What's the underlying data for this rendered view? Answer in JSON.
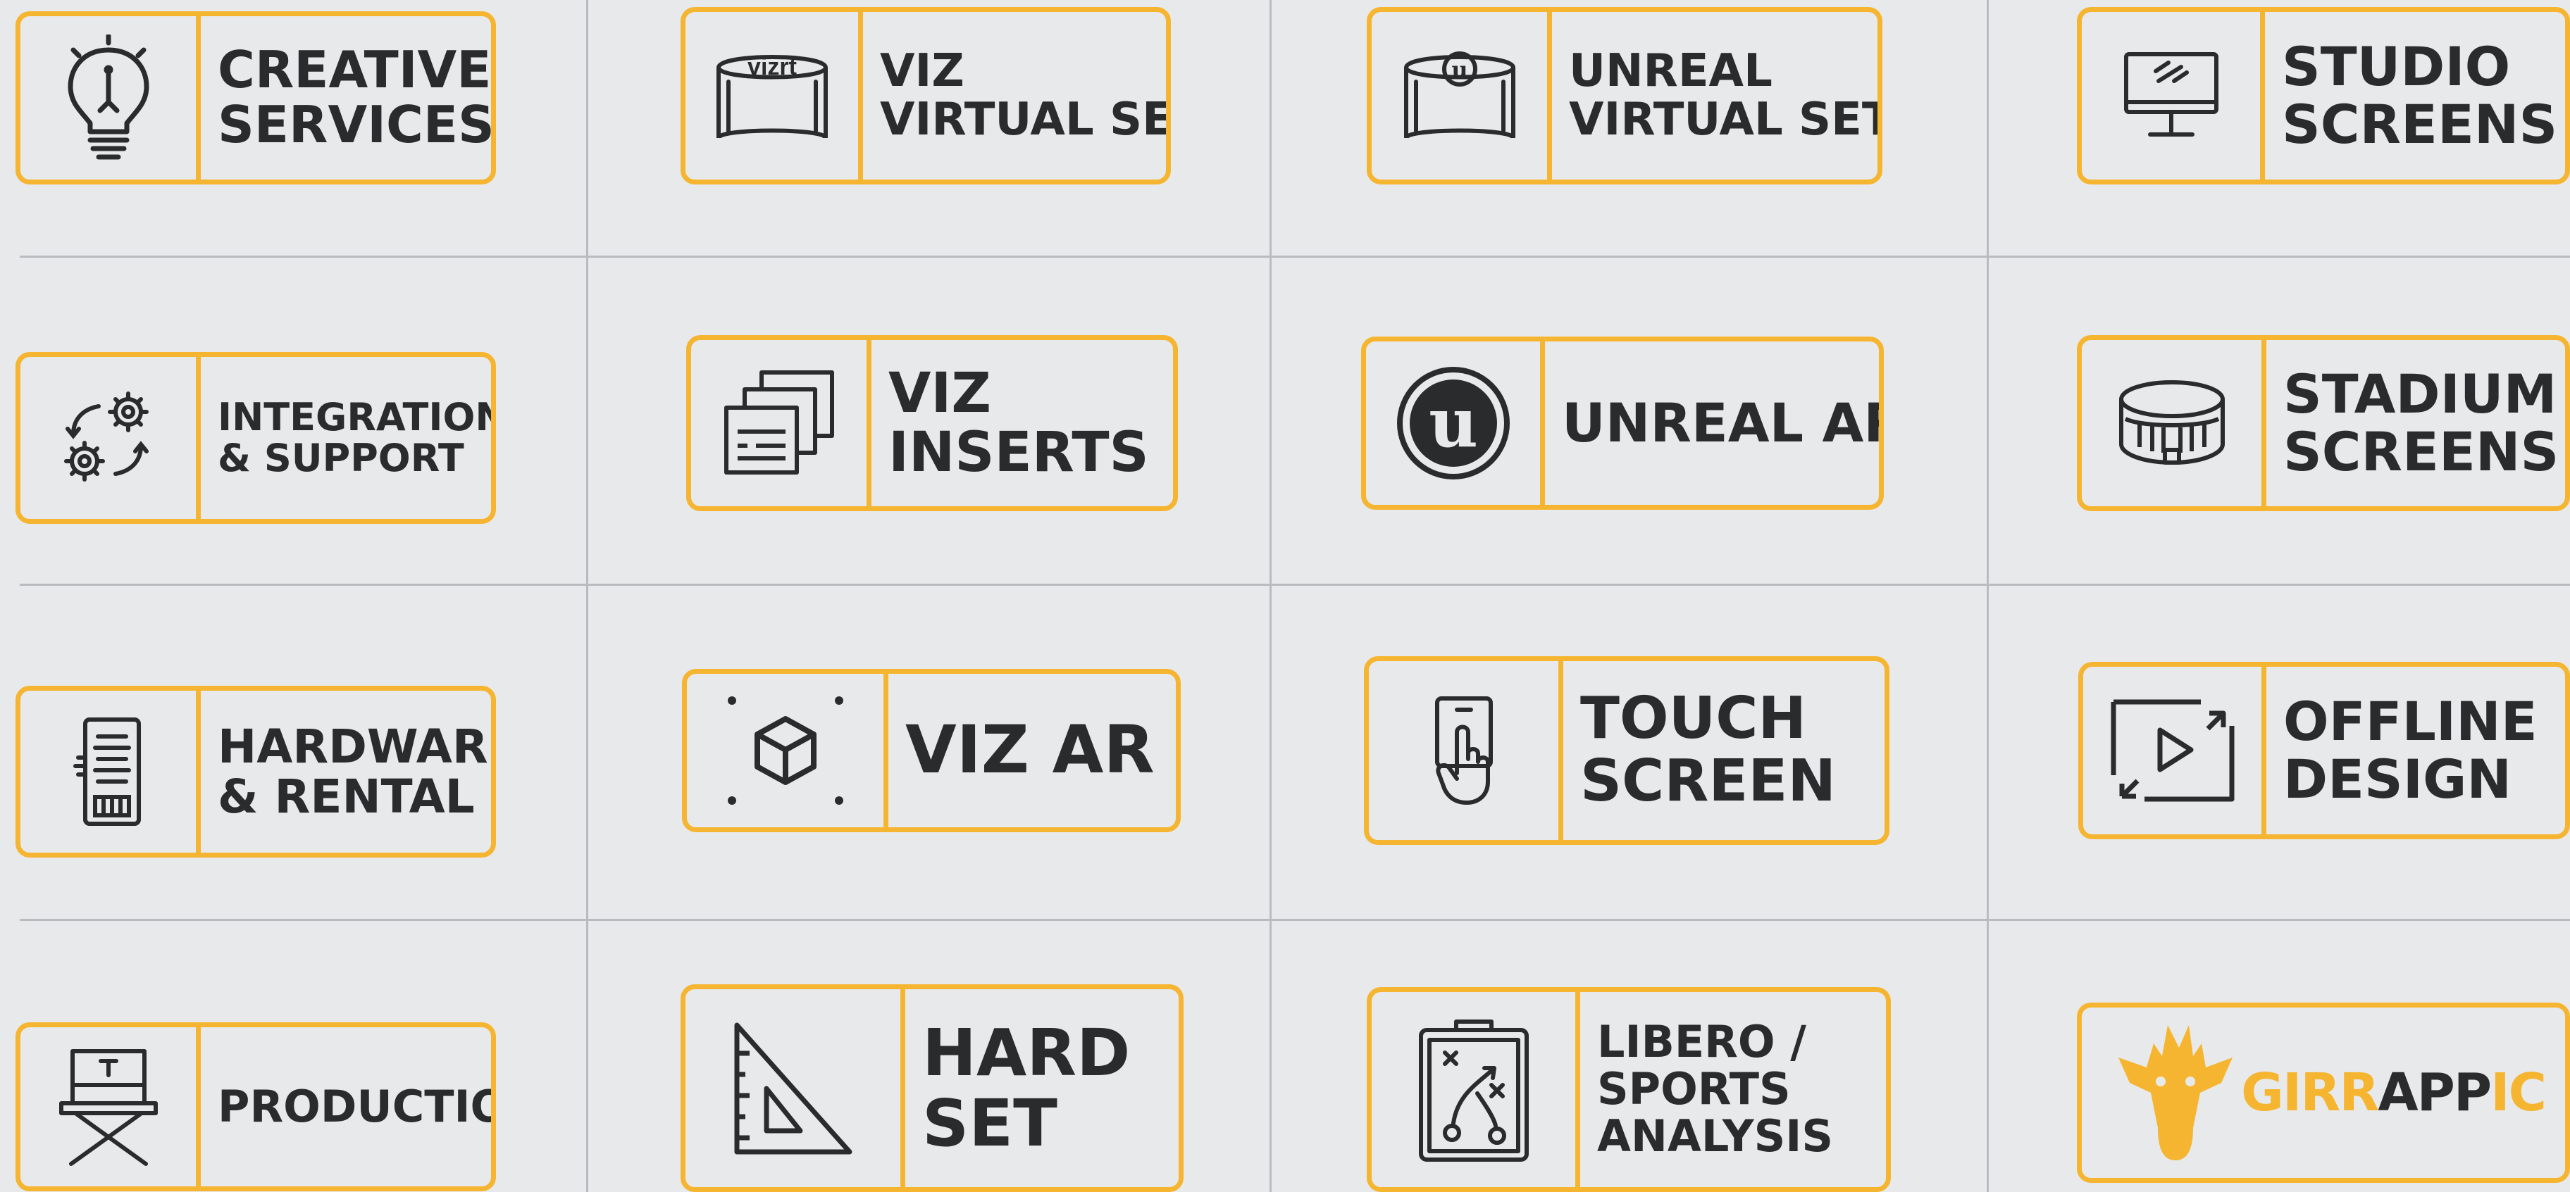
{
  "accent": "#f5b530",
  "text_color": "#2a2b2d",
  "tiles": {
    "creative_services": {
      "icon": "lightbulb-icon",
      "line1": "CREATIVE",
      "line2": "SERVICES"
    },
    "viz_virtual_set": {
      "icon": "vizrt-virtual-set-icon",
      "icon_text": "vizrt",
      "line1": "VIZ",
      "line2": "VIRTUAL SET"
    },
    "unreal_virtual_set": {
      "icon": "unreal-virtual-set-icon",
      "line1": "UNREAL",
      "line2": "VIRTUAL SET"
    },
    "studio_screens": {
      "icon": "monitor-icon",
      "line1": "STUDIO",
      "line2": "SCREENS"
    },
    "integration_support": {
      "icon": "gears-cycle-icon",
      "line1": "INTEGRATION",
      "line2": "& SUPPORT"
    },
    "viz_inserts": {
      "icon": "stacked-windows-icon",
      "line1": "VIZ",
      "line2": "INSERTS"
    },
    "unreal_ar": {
      "icon": "unreal-logo-icon",
      "line1": "UNREAL AR"
    },
    "stadium_screens": {
      "icon": "stadium-icon",
      "line1": "STADIUM",
      "line2": "SCREENS"
    },
    "hardware_rental": {
      "icon": "server-icon",
      "line1": "HARDWARE",
      "line2": "& RENTAL"
    },
    "viz_ar": {
      "icon": "ar-cube-icon",
      "line1": "VIZ AR"
    },
    "touch_screen": {
      "icon": "touch-hand-icon",
      "line1": "TOUCH",
      "line2": "SCREEN"
    },
    "offline_design": {
      "icon": "play-frame-icon",
      "line1": "OFFLINE",
      "line2": "DESIGN"
    },
    "production": {
      "icon": "director-chair-icon",
      "line1": "PRODUCTION"
    },
    "hard_set": {
      "icon": "set-square-icon",
      "line1": "HARD",
      "line2": "SET"
    },
    "libero": {
      "icon": "tactics-clipboard-icon",
      "line1": "LIBERO /",
      "line2": "SPORTS",
      "line3": "ANALYSIS"
    },
    "girrappic": {
      "icon": "giraffe-logo-icon",
      "logo_part1": "GIRR",
      "logo_part2": "APP",
      "logo_part3": "IC"
    }
  }
}
